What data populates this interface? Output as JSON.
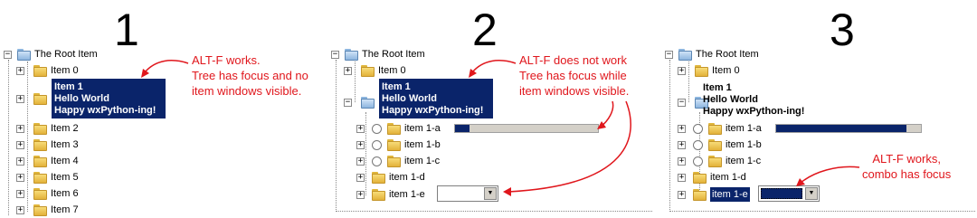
{
  "panels": [
    {
      "number": "1",
      "root_label": "The Root Item",
      "items": [
        "Item 0",
        "Item 2",
        "Item 3",
        "Item 4",
        "Item 5",
        "Item 6",
        "Item 7"
      ],
      "multiline": [
        "Item 1",
        "Hello World",
        "Happy wxPython-ing!"
      ],
      "annotation": [
        "ALT-F works.",
        "Tree has focus and no",
        "item windows visible."
      ]
    },
    {
      "number": "2",
      "root_label": "The Root Item",
      "items": [
        "Item 0"
      ],
      "multiline": [
        "Item 1",
        "Hello World",
        "Happy wxPython-ing!"
      ],
      "children": [
        "item 1-a",
        "item 1-b",
        "item 1-c",
        "item 1-d",
        "item 1-e"
      ],
      "gauge_fraction": 0.1,
      "annotation": [
        "ALT-F does not work",
        "Tree has focus while",
        "item windows visible."
      ]
    },
    {
      "number": "3",
      "root_label": "The Root Item",
      "items": [
        "Item 0"
      ],
      "multiline": [
        "Item 1",
        "Hello World",
        "Happy wxPython-ing!"
      ],
      "children": [
        "item 1-a",
        "item 1-b",
        "item 1-c",
        "item 1-d",
        "item 1-e"
      ],
      "gauge_fraction": 0.9,
      "annotation": [
        "ALT-F works,",
        "combo has focus"
      ]
    }
  ],
  "colors": {
    "accent": "#e0161c",
    "selection": "#0a246a"
  }
}
